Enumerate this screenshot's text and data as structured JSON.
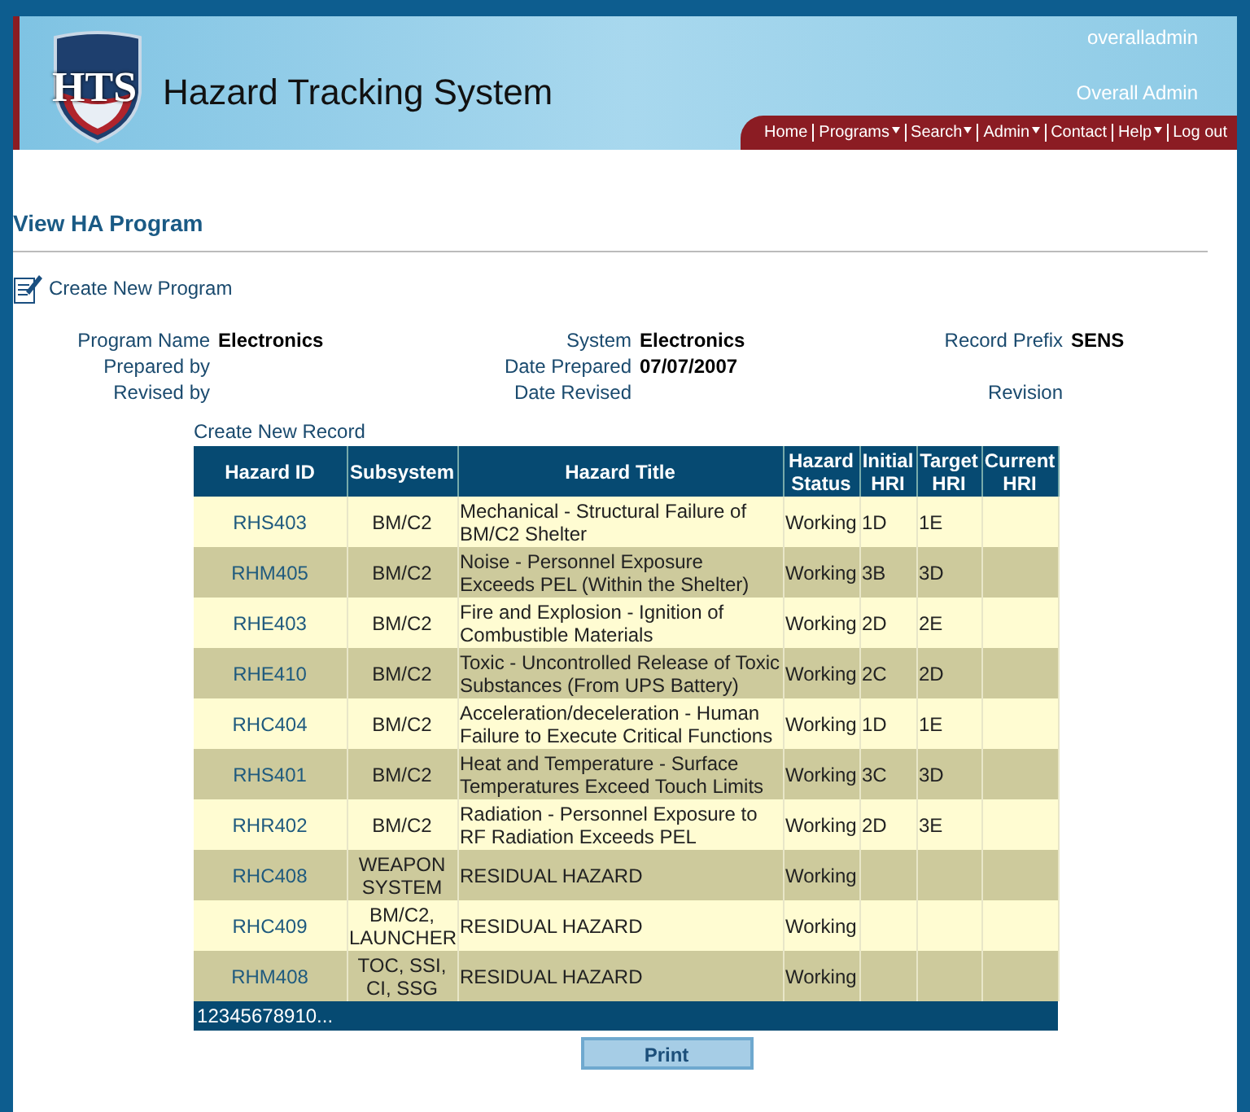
{
  "header": {
    "logo_text": "HTS",
    "app_title": "Hazard Tracking System",
    "username": "overalladmin",
    "role": "Overall Admin",
    "nav": [
      {
        "label": "Home",
        "has_menu": false
      },
      {
        "label": "Programs",
        "has_menu": true
      },
      {
        "label": "Search",
        "has_menu": true
      },
      {
        "label": "Admin",
        "has_menu": true
      },
      {
        "label": "Contact",
        "has_menu": false
      },
      {
        "label": "Help",
        "has_menu": true
      },
      {
        "label": "Log out",
        "has_menu": false
      }
    ]
  },
  "page_title": "View HA Program",
  "create_program_link": "Create New Program",
  "details": [
    [
      {
        "label": "Program Name",
        "value": "Electronics"
      },
      {
        "label": "System",
        "value": "Electronics"
      },
      {
        "label": "Record Prefix",
        "value": "SENS"
      }
    ],
    [
      {
        "label": "Prepared by"
      },
      {
        "label": "Date Prepared",
        "value": "07/07/2007"
      }
    ],
    [
      {
        "label": "Revised by"
      },
      {
        "label": "Date Revised"
      },
      {
        "label": "Revision"
      }
    ]
  ],
  "create_record_link": "Create New Record",
  "table": {
    "columns": [
      "Hazard ID",
      "Subsystem",
      "Hazard Title",
      "Hazard Status",
      "Initial HRI",
      "Target HRI",
      "Current HRI"
    ],
    "rows": [
      [
        "RHS403",
        "BM/C2",
        "Mechanical - Structural Failure of BM/C2 Shelter",
        "Working",
        "1D",
        "1E",
        ""
      ],
      [
        "RHM405",
        "BM/C2",
        "Noise - Personnel Exposure Exceeds PEL (Within the Shelter)",
        "Working",
        "3B",
        "3D",
        ""
      ],
      [
        "RHE403",
        "BM/C2",
        "Fire and Explosion - Ignition of Combustible Materials",
        "Working",
        "2D",
        "2E",
        ""
      ],
      [
        "RHE410",
        "BM/C2",
        "Toxic - Uncontrolled Release of Toxic Substances (From UPS Battery)",
        "Working",
        "2C",
        "2D",
        ""
      ],
      [
        "RHC404",
        "BM/C2",
        "Acceleration/deceleration - Human Failure to Execute Critical Functions",
        "Working",
        "1D",
        "1E",
        ""
      ],
      [
        "RHS401",
        "BM/C2",
        "Heat and Temperature - Surface Temperatures Exceed Touch Limits",
        "Working",
        "3C",
        "3D",
        ""
      ],
      [
        "RHR402",
        "BM/C2",
        "Radiation - Personnel Exposure to RF Radiation Exceeds PEL",
        "Working",
        "2D",
        "3E",
        ""
      ],
      [
        "RHC408",
        "WEAPON SYSTEM",
        "RESIDUAL HAZARD",
        "Working",
        "",
        "",
        ""
      ],
      [
        "RHC409",
        "BM/C2, LAUNCHER",
        "RESIDUAL HAZARD",
        "Working",
        "",
        "",
        ""
      ],
      [
        "RHM408",
        "TOC, SSI, CI, SSG",
        "RESIDUAL HAZARD",
        "Working",
        "",
        "",
        ""
      ]
    ]
  },
  "pagination": [
    "1",
    "2",
    "3",
    "4",
    "5",
    "6",
    "7",
    "8",
    "9",
    "10",
    "..."
  ],
  "print_button": "Print"
}
